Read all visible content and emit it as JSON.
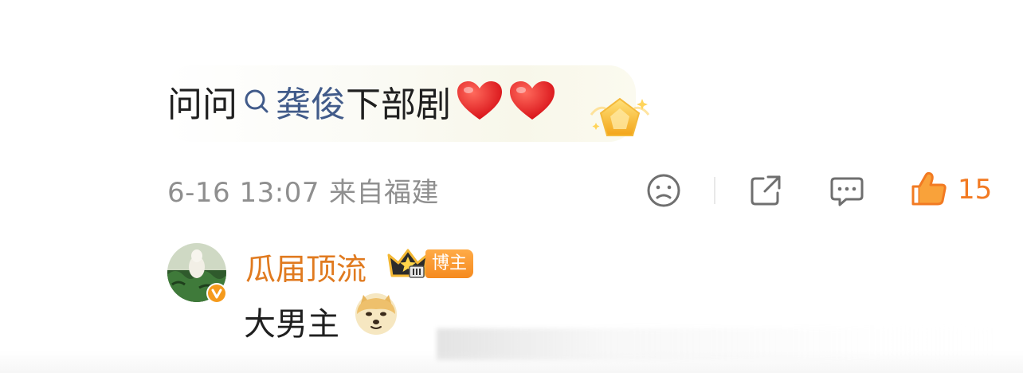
{
  "comment": {
    "prefix": "问问",
    "mention": "龚俊",
    "suffix": "下部剧",
    "emoji": [
      "heart-icon",
      "heart-icon"
    ],
    "badge": "star-badge-icon"
  },
  "meta": {
    "time": "6-16 13:07",
    "location": "来自福建"
  },
  "actions": {
    "like_count": "15",
    "icons": [
      "dislike-face-icon",
      "share-icon",
      "comment-icon",
      "like-thumb-icon"
    ]
  },
  "reply": {
    "author": "瓜届顶流",
    "tag": "博主",
    "text": "大男主",
    "emoji": "doge-icon"
  },
  "colors": {
    "mention": "#415b8a",
    "accent": "#f27a22",
    "author": "#e07a1f",
    "meta": "#8f8f8f"
  }
}
